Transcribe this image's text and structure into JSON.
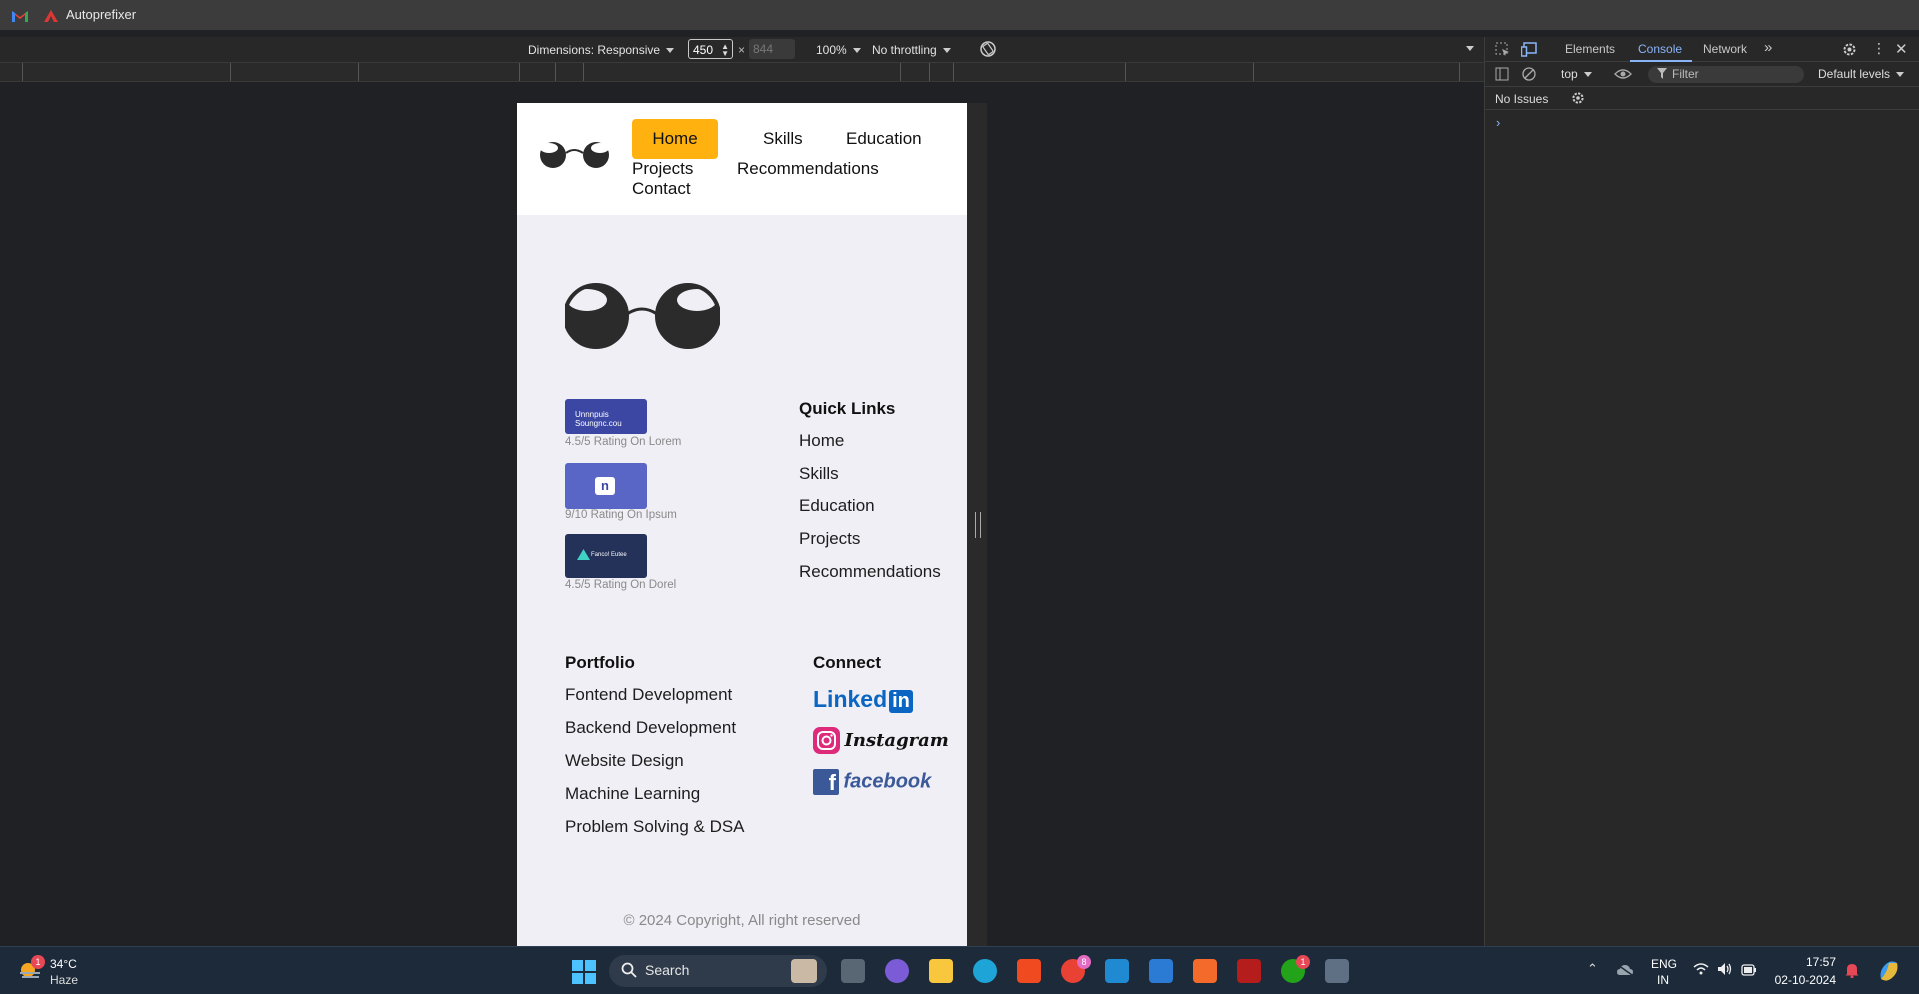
{
  "browser": {
    "tab_title": "Autoprefixer"
  },
  "device_toolbar": {
    "dimensions_label": "Dimensions: Responsive",
    "width_value": "450",
    "separator": "×",
    "height_value": "844",
    "zoom_label": "100%",
    "throttling_label": "No throttling"
  },
  "site": {
    "nav": {
      "home": "Home",
      "skills": "Skills",
      "education": "Education",
      "projects": "Projects",
      "recommendations": "Recommendations",
      "contact": "Contact"
    },
    "ratings": [
      {
        "logo_text": "Unnnpuis Soungnc.cou",
        "caption": "4.5/5 Rating On Lorem",
        "color": "#3b47a3"
      },
      {
        "logo_text": "n",
        "caption": "9/10 Rating On Ipsum",
        "color": "#5a66c6"
      },
      {
        "logo_text": "Fanco! Eutee",
        "caption": "4.5/5 Rating On Dorel",
        "color": "#24325a"
      }
    ],
    "quick_links": {
      "heading": "Quick Links",
      "items": [
        "Home",
        "Skills",
        "Education",
        "Projects",
        "Recommendations"
      ]
    },
    "portfolio": {
      "heading": "Portfolio",
      "items": [
        "Fontend Development",
        "Backend Development",
        "Website Design",
        "Machine Learning",
        "Problem Solving & DSA"
      ]
    },
    "connect": {
      "heading": "Connect",
      "linkedin": "Linked",
      "linkedin_in": "in",
      "instagram": "Instagram",
      "facebook": "facebook"
    },
    "copyright": "© 2024 Copyright, All right reserved",
    "accent_color": "#ffb20f"
  },
  "devtools": {
    "tabs": {
      "elements": "Elements",
      "console": "Console",
      "network": "Network"
    },
    "context": "top",
    "filter_placeholder": "Filter",
    "levels": "Default levels",
    "issues": "No Issues",
    "prompt": "›"
  },
  "taskbar": {
    "weather_temp": "34°C",
    "weather_desc": "Haze",
    "search_label": "Search",
    "lang_line1": "ENG",
    "lang_line2": "IN",
    "time": "17:57",
    "date": "02-10-2024",
    "weather_badge": "1",
    "chrome_badge": "8",
    "xbox_badge": "1"
  }
}
